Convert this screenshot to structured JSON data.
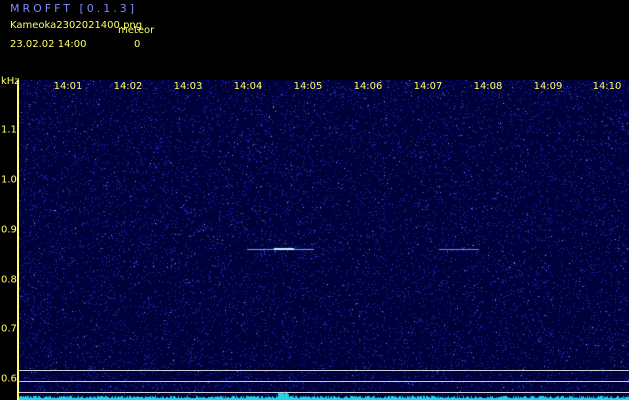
{
  "header": {
    "app_title": "MROFFT [0.1.3]",
    "filename": "Kameoka2302021400.png",
    "meteor_label": "meteor",
    "timestamp": "23.02.02  14:00",
    "meteor_count": "0"
  },
  "axes": {
    "y_unit": "kHz",
    "x_ticks": [
      "14:01",
      "14:02",
      "14:03",
      "14:04",
      "14:05",
      "14:06",
      "14:07",
      "14:08",
      "14:09",
      "14:10"
    ],
    "y_ticks": [
      "1.1",
      "1.0",
      "0.9",
      "0.8",
      "0.7",
      "0.6"
    ]
  },
  "colors": {
    "background": "#00003a",
    "noise_dim": "#1a2ab0",
    "noise_bright": "#8899ff",
    "label": "#ffff66",
    "title": "#7b8cff",
    "bottom_trace": "#22d3e8",
    "meteor_echo": "#bff6ff"
  }
}
